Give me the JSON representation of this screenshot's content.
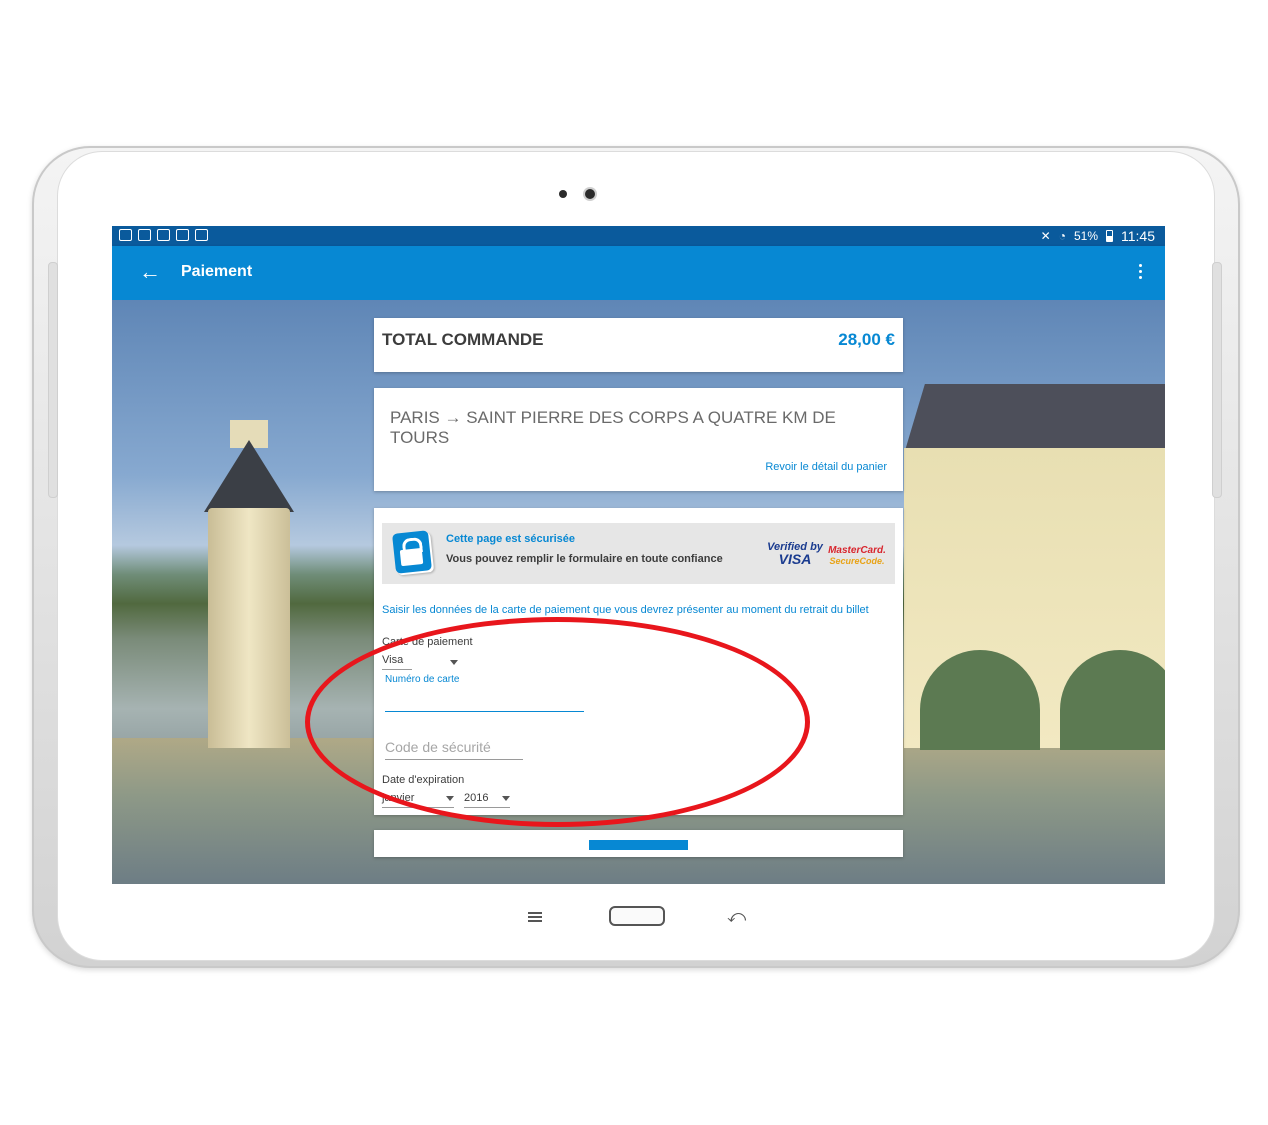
{
  "statusbar": {
    "battery": "51%",
    "time": "11:45",
    "notification_icons": [
      "image-icon",
      "dropbox-icon",
      "clipboard-check-icon",
      "clipboard-icon",
      "clipboard-icon"
    ],
    "right_icons": [
      "mute-icon",
      "wifi-icon",
      "battery-icon"
    ]
  },
  "appbar": {
    "title": "Paiement"
  },
  "order": {
    "total_label": "TOTAL COMMANDE",
    "total_amount": "28,00 €"
  },
  "trip": {
    "title": "PARIS → SAINT PIERRE DES CORPS  A QUATRE KM DE TOURS",
    "detail_link": "Revoir le détail du panier"
  },
  "security": {
    "title": "Cette page est sécurisée",
    "text": "Vous pouvez remplir le formulaire en toute confiance",
    "verified_by": "Verified by",
    "visa": "VISA",
    "mastercard": "MasterCard.",
    "securecode": "SecureCode."
  },
  "form": {
    "instructions": "Saisir les données de la carte de paiement que vous devrez présenter au moment du retrait du billet",
    "card_type_label": "Carte de paiement",
    "card_type_value": "Visa",
    "card_number_label": "Numéro de carte",
    "card_number_value": "",
    "security_code_placeholder": "Code de sécurité",
    "expiry_label": "Date d'expiration",
    "expiry_month": "janvier",
    "expiry_year": "2016"
  },
  "colors": {
    "primary": "#0788d3",
    "statusbar": "#0a5a9c",
    "annotation": "#e8161c"
  }
}
